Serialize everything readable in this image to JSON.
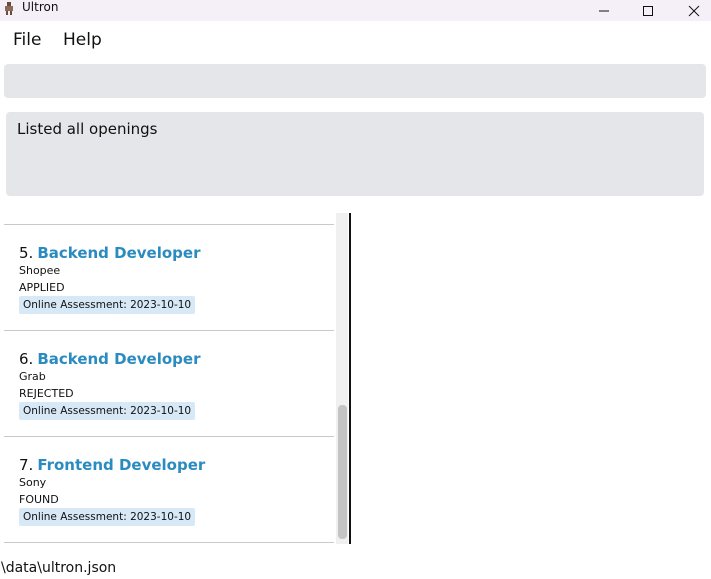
{
  "window": {
    "title": "Ultron"
  },
  "menu": {
    "file": "File",
    "help": "Help"
  },
  "command": {
    "value": "",
    "placeholder": ""
  },
  "result": {
    "text": "Listed all openings"
  },
  "openings": [
    {
      "index": "5.",
      "role": "Backend Developer",
      "company": "Shopee",
      "status": "APPLIED",
      "tag": "Online Assessment: 2023-10-10"
    },
    {
      "index": "6.",
      "role": "Backend Developer",
      "company": "Grab",
      "status": "REJECTED",
      "tag": "Online Assessment: 2023-10-10"
    },
    {
      "index": "7.",
      "role": "Frontend Developer",
      "company": "Sony",
      "status": "FOUND",
      "tag": "Online Assessment: 2023-10-10"
    }
  ],
  "status_bar": {
    "path": "\\data\\ultron.json"
  },
  "colors": {
    "role_text": "#2a8bc0",
    "tag_bg": "#d7e9f7",
    "panel_bg": "#e4e6e9"
  }
}
